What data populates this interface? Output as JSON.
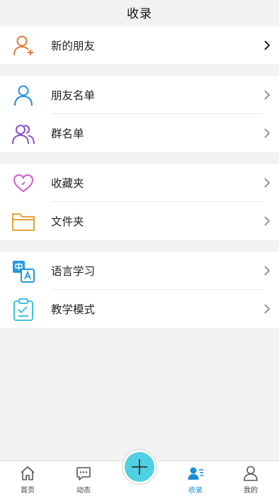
{
  "header": {
    "title": "收录"
  },
  "groups": [
    {
      "items": [
        {
          "label": "新的朋友",
          "icon": "add-friend-icon",
          "color": "#e07a3a"
        }
      ]
    },
    {
      "items": [
        {
          "label": "朋友名单",
          "icon": "person-icon",
          "color": "#1f8ee0"
        },
        {
          "label": "群名单",
          "icon": "group-icon",
          "color": "#8a4fc4"
        }
      ]
    },
    {
      "items": [
        {
          "label": "收藏夹",
          "icon": "heart-icon",
          "color": "#d25ccd"
        },
        {
          "label": "文件夹",
          "icon": "folder-icon",
          "color": "#e8a23a"
        }
      ]
    },
    {
      "items": [
        {
          "label": "语言学习",
          "icon": "language-icon",
          "color": "#1f9be0"
        },
        {
          "label": "教学模式",
          "icon": "clipboard-icon",
          "color": "#3fc3d8"
        }
      ]
    }
  ],
  "tabs": [
    {
      "label": "首页",
      "icon": "home-icon"
    },
    {
      "label": "动态",
      "icon": "chat-icon"
    },
    {
      "label": "",
      "icon": "plus-icon"
    },
    {
      "label": "收录",
      "icon": "contacts-icon",
      "active": true
    },
    {
      "label": "我的",
      "icon": "user-icon"
    }
  ],
  "colors": {
    "accent": "#1a8cd8",
    "fab": "#4fd0e3"
  }
}
